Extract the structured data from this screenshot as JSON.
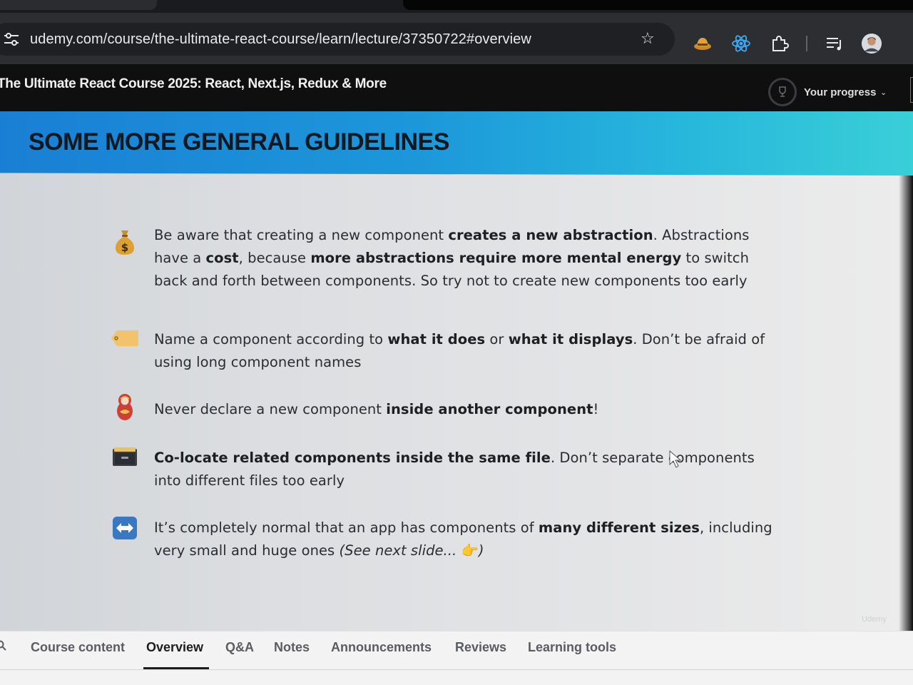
{
  "browser": {
    "url": "udemy.com/course/the-ultimate-react-course/learn/lecture/37350722#overview",
    "icons": [
      "site-settings-icon",
      "bookmark-star-icon",
      "hat-extension-icon",
      "react-devtools-icon",
      "extensions-puzzle-icon",
      "reading-list-icon",
      "profile-avatar"
    ]
  },
  "header": {
    "course_title": "The Ultimate React Course 2025: React, Next.js, Redux & More",
    "progress_label": "Your progress",
    "progress_icon": "trophy-icon"
  },
  "slide": {
    "title_regular": "SOME MORE GENERAL ",
    "title_bold": "GUIDELINES",
    "guidelines": [
      {
        "icon": "money-bag-icon",
        "t1": "Be aware that creating a new component ",
        "b1": "creates a new abstraction",
        "t2": ". Abstractions have a ",
        "b2": "cost",
        "t3": ", because ",
        "b3": "more abstractions require more mental energy",
        "t4": " to switch back and forth between components. So try not to create new components too early"
      },
      {
        "icon": "label-tag-icon",
        "t1": "Name a component according to ",
        "b1": "what it does",
        "t2": " or ",
        "b2": "what it displays",
        "t3": ". Don’t be afraid of using long component names"
      },
      {
        "icon": "nesting-doll-icon",
        "t1": "Never declare a new component ",
        "b1": "inside another component",
        "t2": "!"
      },
      {
        "icon": "file-cabinet-icon",
        "b1": "Co-locate related components inside the same file",
        "t1": ". Don’t separate components into different files too early"
      },
      {
        "icon": "left-right-arrow-icon",
        "t1": "It’s completely normal that an app has components of ",
        "b1": "many different sizes",
        "t2": ", including very small and huge ones ",
        "i1": "(See next slide... ",
        "emoji": "👉",
        "i2": ")"
      }
    ],
    "watermark": "Udemy"
  },
  "tabs": {
    "items": [
      "Course content",
      "Overview",
      "Q&A",
      "Notes",
      "Announcements",
      "Reviews",
      "Learning tools"
    ],
    "active": "Overview"
  }
}
